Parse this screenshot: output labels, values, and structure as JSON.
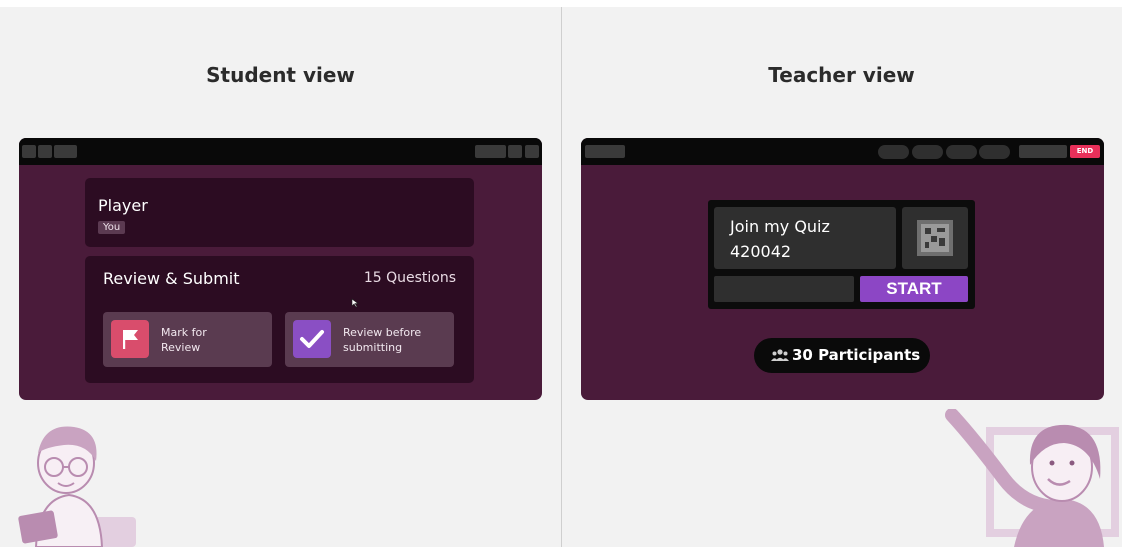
{
  "student": {
    "heading": "Student view",
    "player_label": "Player",
    "you_tag": "You",
    "review_title": "Review & Submit",
    "question_count": "15 Questions",
    "options": [
      {
        "label_line1": "Mark for",
        "label_line2": "Review",
        "icon": "flag-icon",
        "color": "#d94d6c"
      },
      {
        "label_line1": "Review before",
        "label_line2": "submitting",
        "icon": "check-icon",
        "color": "#8a4fc4"
      }
    ]
  },
  "teacher": {
    "heading": "Teacher view",
    "end_label": "END",
    "join_title": "Join my Quiz",
    "join_code": "420042",
    "start_label": "START",
    "participants_label": "30 Participants",
    "participants_icon": "people-icon"
  },
  "colors": {
    "window_bg": "#4a1b3a",
    "card_bg": "#2c0c22",
    "start_button": "#8c46c5",
    "end_button": "#e8305a",
    "illustration": "#c9a3c1"
  }
}
